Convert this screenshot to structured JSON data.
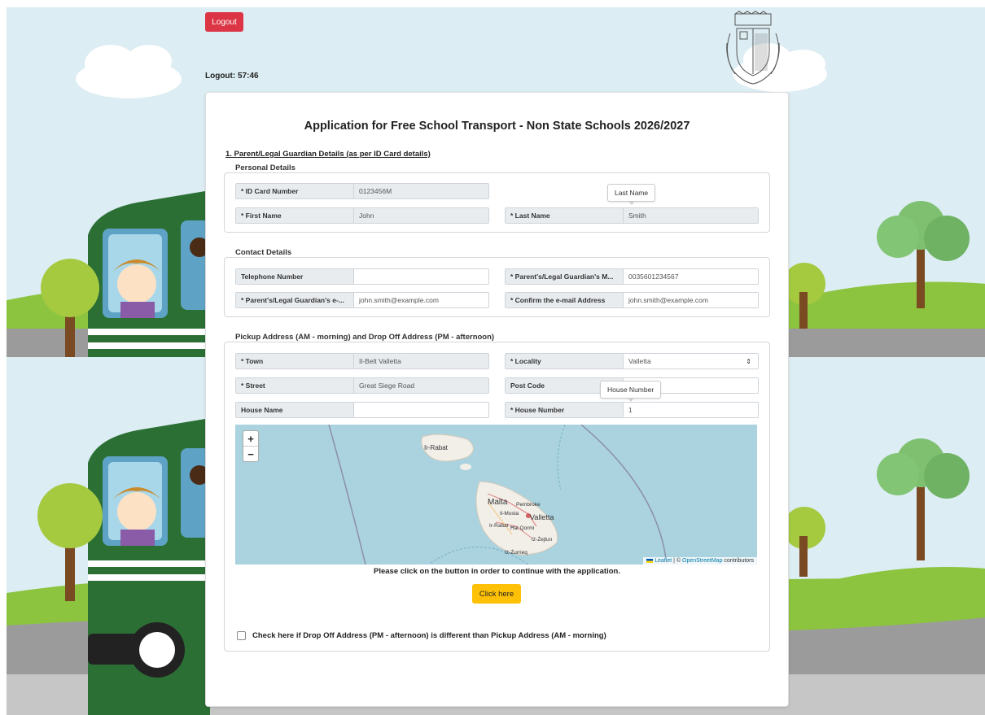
{
  "header": {
    "logout_label": "Logout",
    "timer_label": "Logout:",
    "timer_value": "57:46"
  },
  "form": {
    "title": "Application for Free School Transport - Non State Schools 2026/2027",
    "section_heading": "1. Parent/Legal Guardian Details (as per ID Card details)",
    "personal": {
      "heading": "Personal Details",
      "id_card_label": "* ID Card Number",
      "id_card_value": "0123456M",
      "first_name_label": "* First Name",
      "first_name_value": "John",
      "last_name_label": "* Last Name",
      "last_name_value": "Smith",
      "last_name_tooltip": "Last Name"
    },
    "contact": {
      "heading": "Contact Details",
      "telephone_label": "Telephone Number",
      "telephone_value": "",
      "mobile_label": "* Parent's/Legal Guardian's M...",
      "mobile_value": "0035601234567",
      "email_label": "* Parent's/Legal Guardian's e-...",
      "email_value": "john.smith@example.com",
      "confirm_email_label": "* Confirm the e-mail Address",
      "confirm_email_value": "john.smith@example.com"
    },
    "address": {
      "heading": "Pickup Address (AM - morning) and Drop Off Address (PM - afternoon)",
      "town_label": "* Town",
      "town_value": "Il-Belt Valletta",
      "locality_label": "* Locality",
      "locality_value": "Valletta",
      "street_label": "* Street",
      "street_value": "Great Siege Road",
      "post_code_label": "Post Code",
      "post_code_value": "",
      "house_name_label": "House Name",
      "house_name_value": "",
      "house_number_label": "* House Number",
      "house_number_value": "1",
      "house_number_tooltip": "House Number"
    },
    "map": {
      "zoom_in": "+",
      "zoom_out": "−",
      "labels": [
        "Ir-Rabat",
        "Malta",
        "Pembroke",
        "Il-Mosta",
        "Valletta",
        "Ir-Rabat",
        "Ħal Qormi",
        "Iż-Żejtun",
        "Iż-Żurrieq"
      ],
      "attribution_leaflet": "Leaflet",
      "attribution_sep": " | © ",
      "attribution_osm": "OpenStreetMap",
      "attribution_rest": " contributors"
    },
    "instruction": "Please click on the button in order to continue with the application.",
    "click_here_label": "Click here",
    "dropoff_checkbox_label": "Check here if Drop Off Address (PM - afternoon) is different than Pickup Address (AM - morning)"
  },
  "colors": {
    "logout": "#dc3545",
    "click_here": "#ffc107",
    "sea": "#aad3df",
    "land": "#f2efe9",
    "bus": "#2b6f35"
  }
}
